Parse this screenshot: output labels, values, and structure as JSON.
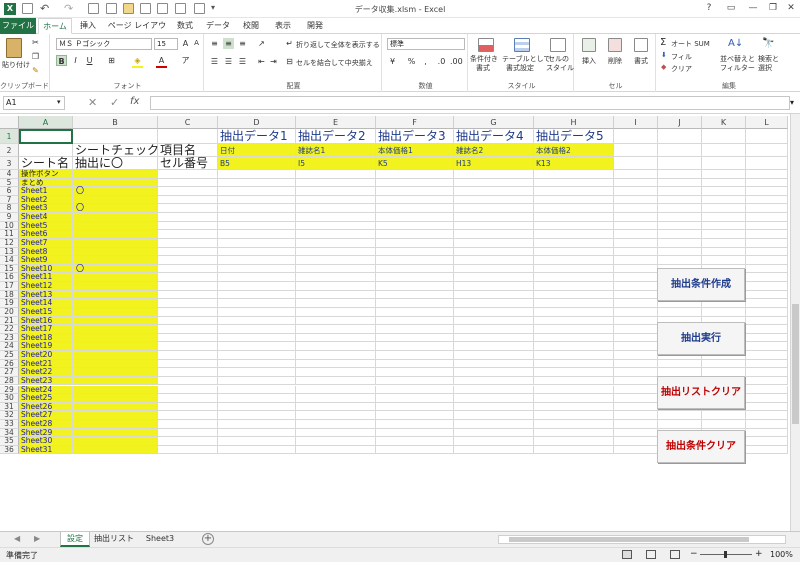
{
  "window": {
    "title": "データ収集.xlsm - Excel"
  },
  "ribbon_tabs": [
    "ファイル",
    "ホーム",
    "挿入",
    "ページ レイアウト",
    "数式",
    "データ",
    "校閲",
    "表示",
    "開発"
  ],
  "ribbon": {
    "clipboard": {
      "paste": "貼り付け",
      "label": "クリップボード"
    },
    "font": {
      "name": "ＭＳ Ｐゴシック",
      "size": "15",
      "label": "フォント",
      "bold": "B",
      "italic": "I",
      "underline": "U",
      "grow": "A",
      "shrink": "A"
    },
    "alignment": {
      "wrap": "折り返して全体を表示する",
      "merge": "セルを結合して中央揃え",
      "label": "配置"
    },
    "number": {
      "format": "標準",
      "label": "数値"
    },
    "styles": {
      "cond": "条件付き",
      "cond2": "書式",
      "table": "テーブルとして",
      "table2": "書式設定",
      "cell": "セルの",
      "cell2": "スタイル",
      "label": "スタイル"
    },
    "cells": {
      "insert": "挿入",
      "delete": "削除",
      "format": "書式",
      "label": "セル"
    },
    "editing": {
      "autosum": "オート SUM",
      "fill": "フィル",
      "clear": "クリア",
      "sort": "並べ替えと",
      "sort2": "フィルター",
      "find": "検索と",
      "find2": "選択",
      "label": "編集"
    }
  },
  "formula_bar": {
    "name_box": "A1",
    "fx": "fx",
    "value": ""
  },
  "columns": [
    "A",
    "B",
    "C",
    "D",
    "E",
    "F",
    "G",
    "H",
    "I",
    "J",
    "K",
    "L"
  ],
  "rows": [
    "1",
    "2",
    "3",
    "4",
    "5",
    "6",
    "7",
    "8",
    "9",
    "10",
    "11",
    "12",
    "13",
    "14",
    "15",
    "16",
    "17",
    "18",
    "19",
    "20",
    "21",
    "22",
    "23",
    "24",
    "25",
    "26",
    "27",
    "28",
    "29",
    "30",
    "31",
    "32",
    "33",
    "34",
    "35",
    "36"
  ],
  "cells": {
    "B2": "シートチェック",
    "C2": "項目名",
    "A3": "シート名",
    "B3": "抽出に〇",
    "C3": "セル番号",
    "A4": "操作ボタン",
    "A5": "まとめ",
    "D1": "抽出データ1",
    "E1": "抽出データ2",
    "F1": "抽出データ3",
    "G1": "抽出データ4",
    "H1": "抽出データ5",
    "D2": "日付",
    "E2": "雑誌名1",
    "F2": "本体価格1",
    "G2": "雑誌名2",
    "H2": "本体価格2",
    "D3": "B5",
    "E3": "I5",
    "F3": "K5",
    "G3": "H13",
    "H3": "K13"
  },
  "sheet_names": [
    "Sheet1",
    "Sheet2",
    "Sheet3",
    "Sheet4",
    "Sheet5",
    "Sheet6",
    "Sheet7",
    "Sheet8",
    "Sheet9",
    "Sheet10",
    "Sheet11",
    "Sheet12",
    "Sheet13",
    "Sheet14",
    "Sheet15",
    "Sheet16",
    "Sheet17",
    "Sheet18",
    "Sheet19",
    "Sheet20",
    "Sheet21",
    "Sheet22",
    "Sheet23",
    "Sheet24",
    "Sheet25",
    "Sheet26",
    "Sheet27",
    "Sheet28",
    "Sheet29",
    "Sheet30",
    "Sheet31"
  ],
  "checks": {
    "Sheet1": "〇",
    "Sheet3": "〇",
    "Sheet10": "〇"
  },
  "buttons": {
    "create": "抽出条件作成",
    "run": "抽出実行",
    "clear_list": "抽出リストクリア",
    "clear_cond": "抽出条件クリア"
  },
  "sheet_tabs": [
    "設定",
    "抽出リスト",
    "Sheet3"
  ],
  "status": {
    "ready": "準備完了",
    "zoom": "100%"
  },
  "colors": {
    "accent": "#217346",
    "highlight": "#f2f21e",
    "header_text": "#1f3c8c",
    "button_red": "#c00000",
    "button_blue": "#1f3c8c"
  }
}
